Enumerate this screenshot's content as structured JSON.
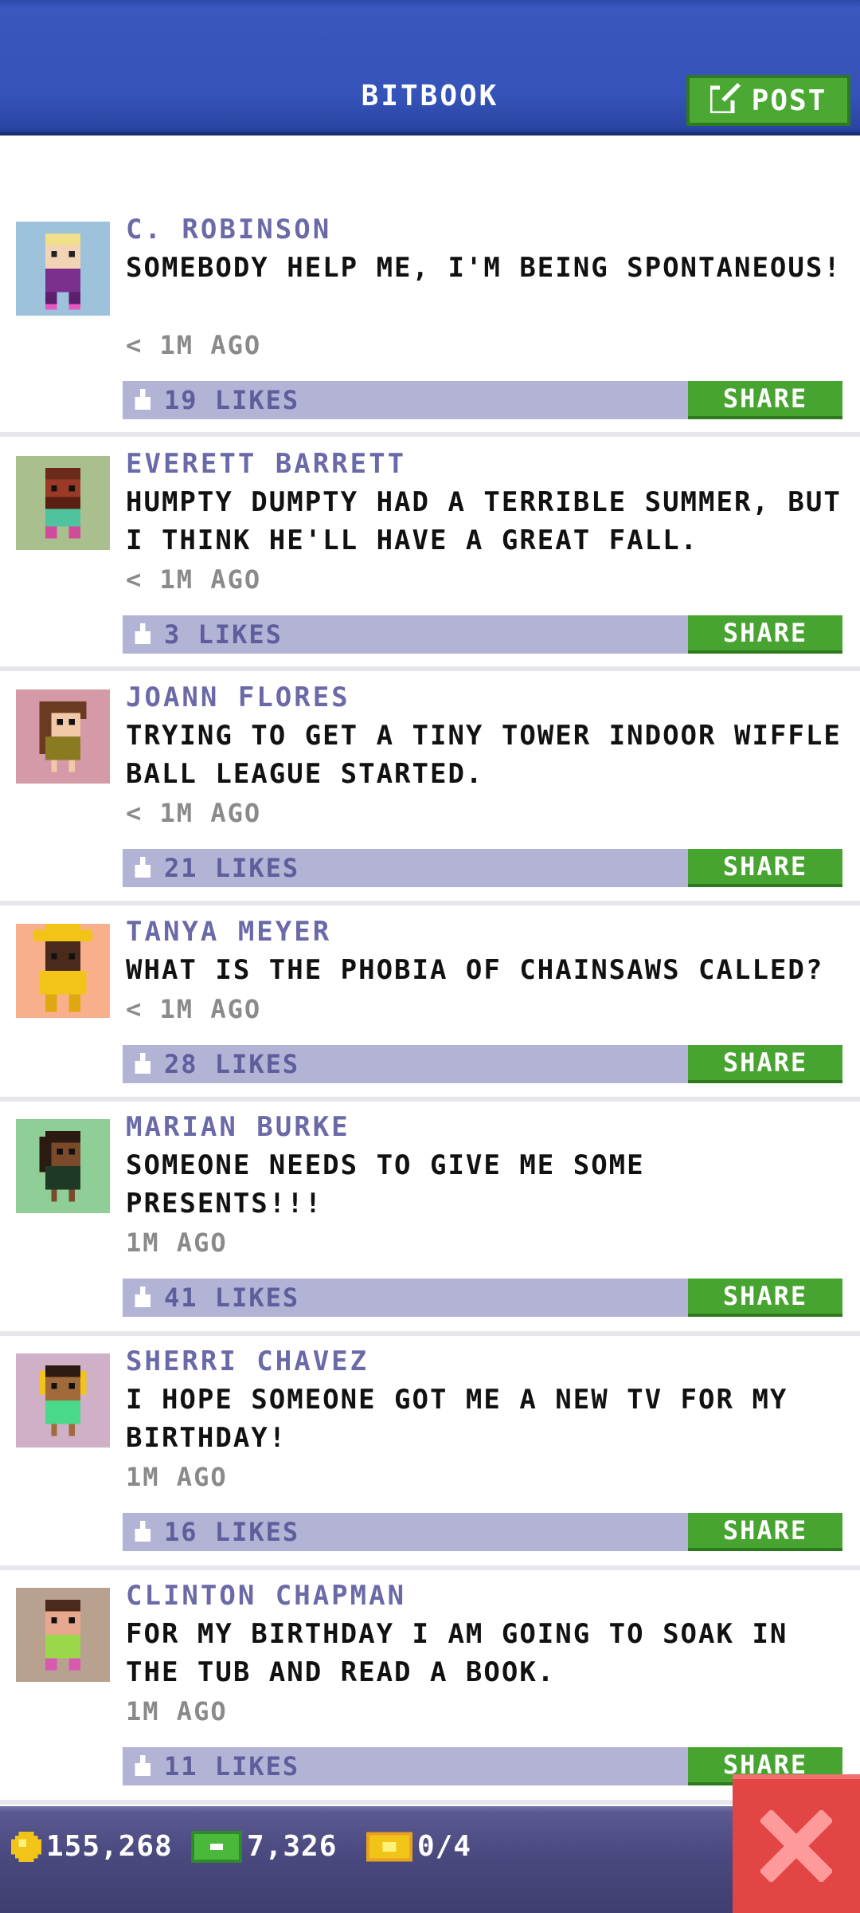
{
  "header": {
    "title": "BITBOOK",
    "post_label": "POST"
  },
  "posts": [
    {
      "name": "C. ROBINSON",
      "message": "SOMEBODY HELP ME, I'M BEING SPONTANEOUS!",
      "time": "< 1M AGO",
      "likes": "19 LIKES",
      "share": "SHARE",
      "avatar_bg": "#9ec1dc"
    },
    {
      "name": "EVERETT BARRETT",
      "message": "HUMPTY DUMPTY HAD A TERRIBLE SUMMER, BUT I THINK HE'LL HAVE A GREAT FALL.",
      "time": "< 1M AGO",
      "likes": "3 LIKES",
      "share": "SHARE",
      "avatar_bg": "#a9bf8e"
    },
    {
      "name": "JOANN FLORES",
      "message": "TRYING TO GET A TINY TOWER INDOOR WIFFLE BALL LEAGUE STARTED.",
      "time": "< 1M AGO",
      "likes": "21 LIKES",
      "share": "SHARE",
      "avatar_bg": "#d49aa8"
    },
    {
      "name": "TANYA MEYER",
      "message": "WHAT IS THE PHOBIA OF CHAINSAWS CALLED?",
      "time": "< 1M AGO",
      "likes": "28 LIKES",
      "share": "SHARE",
      "avatar_bg": "#f8b08c"
    },
    {
      "name": "MARIAN BURKE",
      "message": "SOMEONE NEEDS TO GIVE ME SOME PRESENTS!!!",
      "time": "1M AGO",
      "likes": "41 LIKES",
      "share": "SHARE",
      "avatar_bg": "#8fce96"
    },
    {
      "name": "SHERRI CHAVEZ",
      "message": "I HOPE SOMEONE GOT ME A NEW TV FOR MY BIRTHDAY!",
      "time": "1M AGO",
      "likes": "16 LIKES",
      "share": "SHARE",
      "avatar_bg": "#cfb0c6"
    },
    {
      "name": "CLINTON CHAPMAN",
      "message": "FOR MY BIRTHDAY I AM GOING TO SOAK IN THE TUB AND READ A BOOK.",
      "time": "1M AGO",
      "likes": "11 LIKES",
      "share": "SHARE",
      "avatar_bg": "#b9a190"
    }
  ],
  "bottom_bar": {
    "coins": "155,268",
    "bux": "7,326",
    "tickets": "0/4"
  },
  "colors": {
    "header": "#3553b8",
    "share": "#48a431",
    "likes_bar": "#b3b3d6",
    "name": "#6b6aa8",
    "close": "#e34545"
  },
  "icons": [
    "edit-icon",
    "thumbs-up-icon",
    "coin-icon",
    "bux-icon",
    "ticket-icon",
    "close-icon"
  ]
}
